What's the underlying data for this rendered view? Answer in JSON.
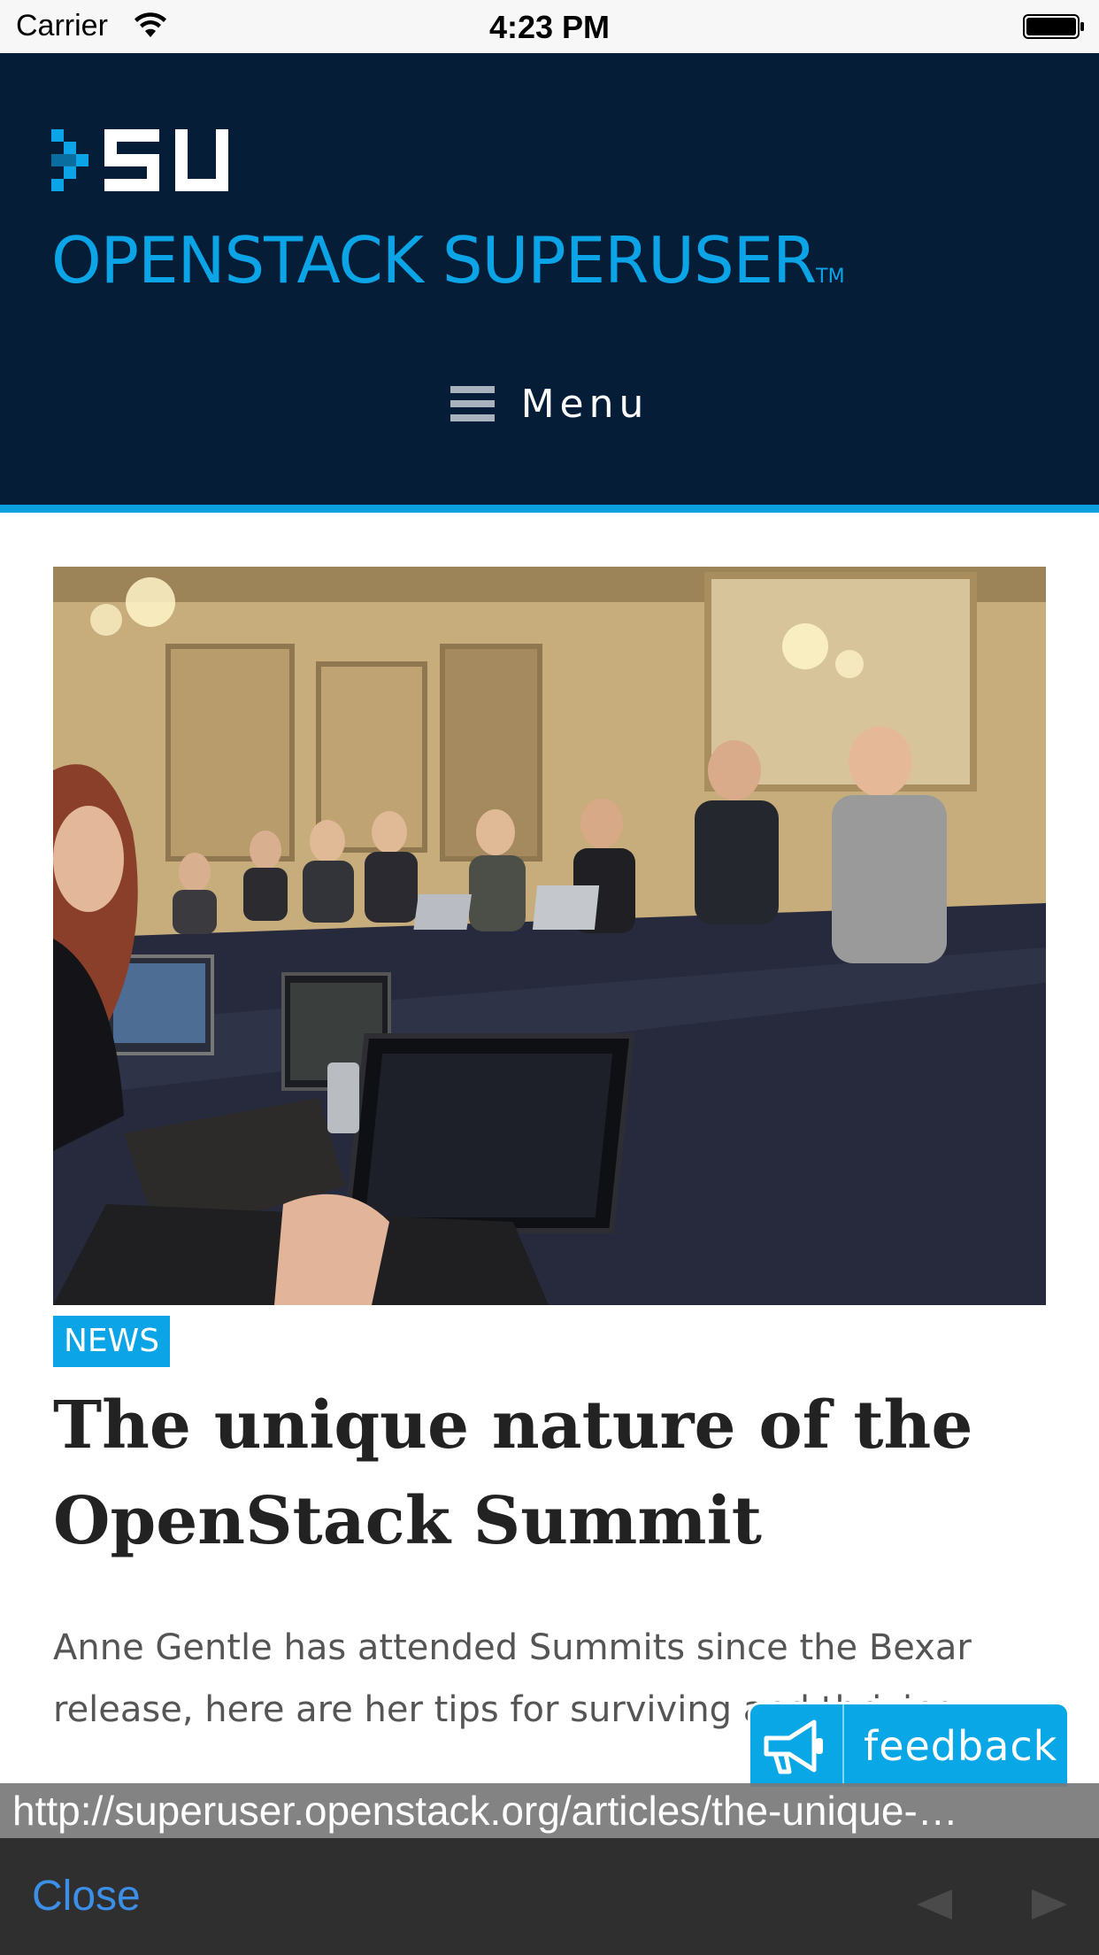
{
  "status_bar": {
    "carrier": "Carrier",
    "time": "4:23 PM"
  },
  "site": {
    "logo_text": "OPENSTACK SUPERUSER",
    "trademark": "TM",
    "menu_label": "Menu"
  },
  "article": {
    "category": "NEWS",
    "title": "The unique nature of the OpenStack Summit",
    "excerpt": "Anne Gentle has attended Summits since the Bexar release, here are her tips for surviving and thriving"
  },
  "feedback": {
    "label": "feedback"
  },
  "url_preview": "http://superuser.openstack.org/articles/the-unique-…",
  "toolbar": {
    "close_label": "Close"
  },
  "colors": {
    "header_bg": "#061d38",
    "brand_blue": "#0ba4e6",
    "toolbar_bg": "#2f2f2f",
    "link_blue": "#3d8ee6"
  },
  "icons": [
    "wifi-icon",
    "battery-icon",
    "su-logo-icon",
    "hamburger-icon",
    "megaphone-icon",
    "back-arrow-icon",
    "forward-arrow-icon"
  ]
}
